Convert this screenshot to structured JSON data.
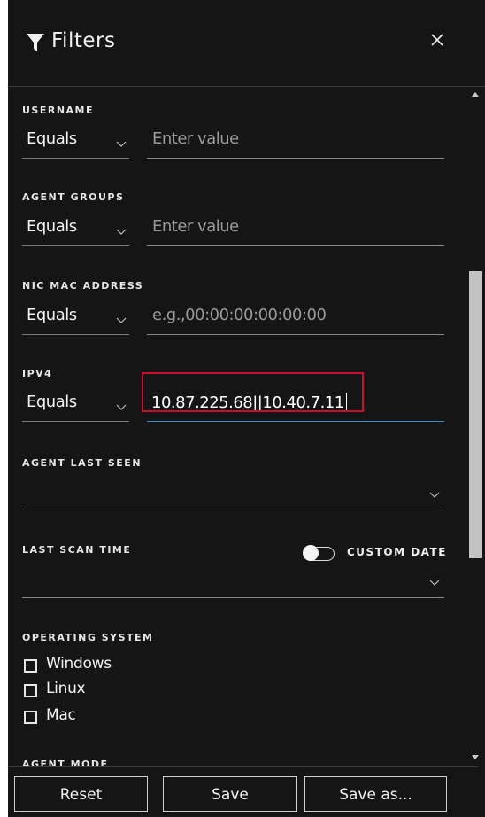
{
  "header": {
    "title": "Filters",
    "icon": "filter-icon",
    "close_icon": "close-icon"
  },
  "fields": {
    "username": {
      "label": "USERNAME",
      "operator": "Equals",
      "placeholder": "Enter value"
    },
    "agent_groups": {
      "label": "AGENT GROUPS",
      "operator": "Equals",
      "placeholder": "Enter value"
    },
    "nic_mac": {
      "label": "NIC MAC ADDRESS",
      "operator": "Equals",
      "placeholder": "e.g.,00:00:00:00:00:00"
    },
    "ipv4": {
      "label": "IPV4",
      "operator": "Equals",
      "value": "10.87.225.68||10.40.7.11"
    },
    "agent_last_seen": {
      "label": "AGENT LAST SEEN",
      "value": ""
    },
    "last_scan_time": {
      "label": "LAST SCAN TIME",
      "value": "",
      "toggle_label": "CUSTOM DATE",
      "toggle_on": false
    },
    "operating_system": {
      "label": "OPERATING SYSTEM",
      "options": [
        {
          "label": "Windows",
          "checked": false
        },
        {
          "label": "Linux",
          "checked": false
        },
        {
          "label": "Mac",
          "checked": false
        }
      ]
    },
    "agent_mode": {
      "label": "AGENT MODE"
    }
  },
  "footer": {
    "reset_label": "Reset",
    "save_label": "Save",
    "save_as_label": "Save as..."
  },
  "colors": {
    "background": "#151515",
    "text": "#f2f2f2",
    "placeholder": "#9a9a9a",
    "focus_underline": "#3a8fc7",
    "highlight_box": "#c8102e"
  }
}
